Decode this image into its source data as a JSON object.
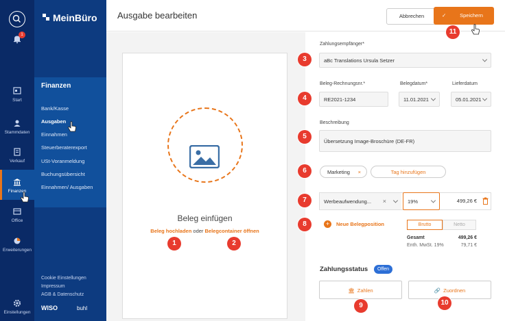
{
  "colors": {
    "rail": "#0a2a66",
    "nav": "#0d3b80",
    "nav_section": "#11509c",
    "accent": "#e8751a",
    "badge": "#e83b2e",
    "status": "#2d6fd6"
  },
  "app": {
    "brand": "MeinBüro"
  },
  "rail": {
    "notification_count": "1",
    "items": [
      {
        "label": "Start"
      },
      {
        "label": "Stammdaten"
      },
      {
        "label": "Verkauf"
      },
      {
        "label": "Finanzen"
      },
      {
        "label": "Office"
      },
      {
        "label": "Erweiterungen"
      },
      {
        "label": "Einstellungen"
      }
    ]
  },
  "nav": {
    "section_title": "Finanzen",
    "links": [
      "Bank/Kasse",
      "Ausgaben",
      "Einnahmen",
      "Steuerberaterexport",
      "USt-Voranmeldung",
      "Buchungsübersicht",
      "Einnahmen/ Ausgaben"
    ],
    "footer": [
      "Cookie Einstellungen",
      "Impressum",
      "AGB & Datenschutz"
    ],
    "footer_logo": "WISO",
    "footer_logo2": "buhl"
  },
  "header": {
    "title": "Ausgabe bearbeiten",
    "cancel_label": "Abbrechen",
    "save_label": "Speichern"
  },
  "upload": {
    "title": "Beleg einfügen",
    "upload_link": "Beleg hochladen",
    "or_text": "oder",
    "container_link": "Belegcontainer öffnen"
  },
  "form": {
    "recipient_label": "Zahlungsempfänger*",
    "recipient_value": "aBc Translations Ursula Setzer",
    "invoice_label": "Beleg-Rechnungsnr.*",
    "invoice_value": "RE2021-1234",
    "date_label": "Belegdatum*",
    "date_value": "11.01.2021",
    "delivery_label": "Lieferdatum",
    "delivery_value": "05.01.2021",
    "desc_label": "Beschreibung",
    "desc_value": "Übersetzung Image-Broschüre (DE-FR)",
    "tag_value": "Marketing",
    "tag_remove": "×",
    "add_tag": "Tag hinzufügen",
    "category_value": "Werbeaufwendung...",
    "category_clear": "×",
    "vat_value": "19%",
    "amount_value": "499,26 €",
    "add_position": "Neue Belegposition",
    "brutto": "Brutto",
    "netto": "Netto",
    "total_label": "Gesamt",
    "total_value": "499,26 €",
    "vat_incl_label": "Enth. MwSt. 19%",
    "vat_incl_value": "79,71 €",
    "status_label": "Zahlungsstatus",
    "status_badge": "Offen",
    "pay_label": "Zahlen",
    "assign_label": "Zuordnen"
  },
  "callouts": [
    "1",
    "2",
    "3",
    "4",
    "5",
    "6",
    "7",
    "8",
    "9",
    "10",
    "11"
  ]
}
